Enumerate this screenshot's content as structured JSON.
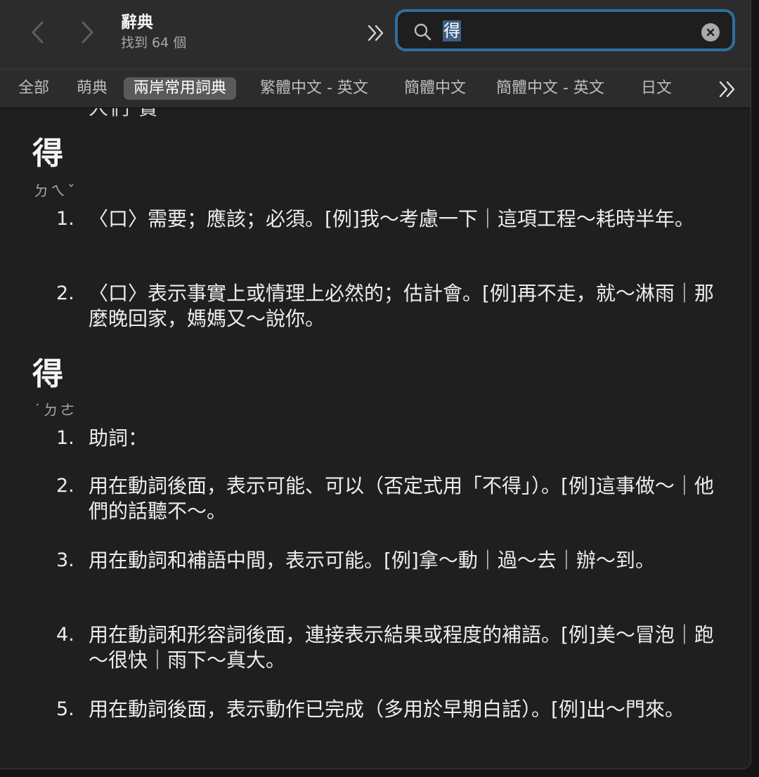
{
  "header": {
    "title": "辭典",
    "result_count": "找到 64 個"
  },
  "search": {
    "query": "得"
  },
  "tabs": [
    {
      "label": "全部",
      "active": false
    },
    {
      "label": "萌典",
      "active": false
    },
    {
      "label": "兩岸常用詞典",
      "active": true
    },
    {
      "label": "繁體中文 - 英文",
      "active": false
    },
    {
      "label": "簡體中文",
      "active": false
    },
    {
      "label": "簡體中文 - 英文",
      "active": false
    },
    {
      "label": "日文",
      "active": false
    }
  ],
  "content": {
    "partial_top_line": "人們 實",
    "entries": [
      {
        "headword": "得",
        "pronunciation": "ㄉㄟˇ",
        "senses": [
          {
            "number": "1.",
            "text": "〈口〉需要；應該；必須。[例]我～考慮一下｜這項工程～耗時半年。"
          },
          {
            "number": "2.",
            "text": "〈口〉表示事實上或情理上必然的；估計會。[例]再不走，就～淋雨｜那麼晚回家，媽媽又～說你。"
          }
        ]
      },
      {
        "headword": "得",
        "pronunciation": "˙ㄉㄜ",
        "senses": [
          {
            "number": "1.",
            "text": "助詞："
          },
          {
            "number": "2.",
            "text": "用在動詞後面，表示可能、可以（否定式用「不得」）。[例]這事做～｜他們的話聽不～。"
          },
          {
            "number": "3.",
            "text": "用在動詞和補語中間，表示可能。[例]拿～動｜過～去｜辦～到。"
          },
          {
            "number": "4.",
            "text": "用在動詞和形容詞後面，連接表示結果或程度的補語。[例]美～冒泡｜跑～很快｜雨下～真大。"
          },
          {
            "number": "5.",
            "text": "用在動詞後面，表示動作已完成（多用於早期白話）。[例]出～門來。"
          }
        ]
      }
    ]
  }
}
